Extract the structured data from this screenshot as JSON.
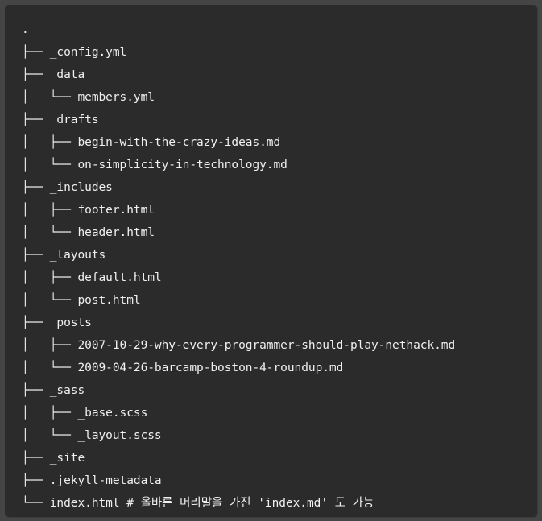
{
  "tree": {
    "root": ".",
    "lines": [
      {
        "prefix": "├── ",
        "name": "_config.yml"
      },
      {
        "prefix": "├── ",
        "name": "_data"
      },
      {
        "prefix": "│   └── ",
        "name": "members.yml"
      },
      {
        "prefix": "├── ",
        "name": "_drafts"
      },
      {
        "prefix": "│   ├── ",
        "name": "begin-with-the-crazy-ideas.md"
      },
      {
        "prefix": "│   └── ",
        "name": "on-simplicity-in-technology.md"
      },
      {
        "prefix": "├── ",
        "name": "_includes"
      },
      {
        "prefix": "│   ├── ",
        "name": "footer.html"
      },
      {
        "prefix": "│   └── ",
        "name": "header.html"
      },
      {
        "prefix": "├── ",
        "name": "_layouts"
      },
      {
        "prefix": "│   ├── ",
        "name": "default.html"
      },
      {
        "prefix": "│   └── ",
        "name": "post.html"
      },
      {
        "prefix": "├── ",
        "name": "_posts"
      },
      {
        "prefix": "│   ├── ",
        "name": "2007-10-29-why-every-programmer-should-play-nethack.md"
      },
      {
        "prefix": "│   └── ",
        "name": "2009-04-26-barcamp-boston-4-roundup.md"
      },
      {
        "prefix": "├── ",
        "name": "_sass"
      },
      {
        "prefix": "│   ├── ",
        "name": "_base.scss"
      },
      {
        "prefix": "│   └── ",
        "name": "_layout.scss"
      },
      {
        "prefix": "├── ",
        "name": "_site"
      },
      {
        "prefix": "├── ",
        "name": ".jekyll-metadata"
      },
      {
        "prefix": "└── ",
        "name": "index.html # 올바른 머리말을 가진 'index.md' 도 가능"
      }
    ]
  }
}
